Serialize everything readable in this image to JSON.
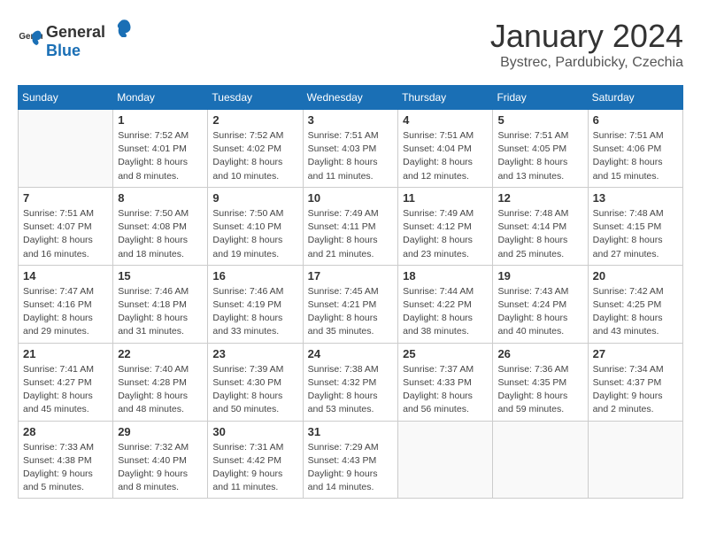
{
  "header": {
    "logo_general": "General",
    "logo_blue": "Blue",
    "month_title": "January 2024",
    "location": "Bystrec, Pardubicky, Czechia"
  },
  "weekdays": [
    "Sunday",
    "Monday",
    "Tuesday",
    "Wednesday",
    "Thursday",
    "Friday",
    "Saturday"
  ],
  "weeks": [
    [
      {
        "day": "",
        "info": ""
      },
      {
        "day": "1",
        "info": "Sunrise: 7:52 AM\nSunset: 4:01 PM\nDaylight: 8 hours\nand 8 minutes."
      },
      {
        "day": "2",
        "info": "Sunrise: 7:52 AM\nSunset: 4:02 PM\nDaylight: 8 hours\nand 10 minutes."
      },
      {
        "day": "3",
        "info": "Sunrise: 7:51 AM\nSunset: 4:03 PM\nDaylight: 8 hours\nand 11 minutes."
      },
      {
        "day": "4",
        "info": "Sunrise: 7:51 AM\nSunset: 4:04 PM\nDaylight: 8 hours\nand 12 minutes."
      },
      {
        "day": "5",
        "info": "Sunrise: 7:51 AM\nSunset: 4:05 PM\nDaylight: 8 hours\nand 13 minutes."
      },
      {
        "day": "6",
        "info": "Sunrise: 7:51 AM\nSunset: 4:06 PM\nDaylight: 8 hours\nand 15 minutes."
      }
    ],
    [
      {
        "day": "7",
        "info": "Sunrise: 7:51 AM\nSunset: 4:07 PM\nDaylight: 8 hours\nand 16 minutes."
      },
      {
        "day": "8",
        "info": "Sunrise: 7:50 AM\nSunset: 4:08 PM\nDaylight: 8 hours\nand 18 minutes."
      },
      {
        "day": "9",
        "info": "Sunrise: 7:50 AM\nSunset: 4:10 PM\nDaylight: 8 hours\nand 19 minutes."
      },
      {
        "day": "10",
        "info": "Sunrise: 7:49 AM\nSunset: 4:11 PM\nDaylight: 8 hours\nand 21 minutes."
      },
      {
        "day": "11",
        "info": "Sunrise: 7:49 AM\nSunset: 4:12 PM\nDaylight: 8 hours\nand 23 minutes."
      },
      {
        "day": "12",
        "info": "Sunrise: 7:48 AM\nSunset: 4:14 PM\nDaylight: 8 hours\nand 25 minutes."
      },
      {
        "day": "13",
        "info": "Sunrise: 7:48 AM\nSunset: 4:15 PM\nDaylight: 8 hours\nand 27 minutes."
      }
    ],
    [
      {
        "day": "14",
        "info": "Sunrise: 7:47 AM\nSunset: 4:16 PM\nDaylight: 8 hours\nand 29 minutes."
      },
      {
        "day": "15",
        "info": "Sunrise: 7:46 AM\nSunset: 4:18 PM\nDaylight: 8 hours\nand 31 minutes."
      },
      {
        "day": "16",
        "info": "Sunrise: 7:46 AM\nSunset: 4:19 PM\nDaylight: 8 hours\nand 33 minutes."
      },
      {
        "day": "17",
        "info": "Sunrise: 7:45 AM\nSunset: 4:21 PM\nDaylight: 8 hours\nand 35 minutes."
      },
      {
        "day": "18",
        "info": "Sunrise: 7:44 AM\nSunset: 4:22 PM\nDaylight: 8 hours\nand 38 minutes."
      },
      {
        "day": "19",
        "info": "Sunrise: 7:43 AM\nSunset: 4:24 PM\nDaylight: 8 hours\nand 40 minutes."
      },
      {
        "day": "20",
        "info": "Sunrise: 7:42 AM\nSunset: 4:25 PM\nDaylight: 8 hours\nand 43 minutes."
      }
    ],
    [
      {
        "day": "21",
        "info": "Sunrise: 7:41 AM\nSunset: 4:27 PM\nDaylight: 8 hours\nand 45 minutes."
      },
      {
        "day": "22",
        "info": "Sunrise: 7:40 AM\nSunset: 4:28 PM\nDaylight: 8 hours\nand 48 minutes."
      },
      {
        "day": "23",
        "info": "Sunrise: 7:39 AM\nSunset: 4:30 PM\nDaylight: 8 hours\nand 50 minutes."
      },
      {
        "day": "24",
        "info": "Sunrise: 7:38 AM\nSunset: 4:32 PM\nDaylight: 8 hours\nand 53 minutes."
      },
      {
        "day": "25",
        "info": "Sunrise: 7:37 AM\nSunset: 4:33 PM\nDaylight: 8 hours\nand 56 minutes."
      },
      {
        "day": "26",
        "info": "Sunrise: 7:36 AM\nSunset: 4:35 PM\nDaylight: 8 hours\nand 59 minutes."
      },
      {
        "day": "27",
        "info": "Sunrise: 7:34 AM\nSunset: 4:37 PM\nDaylight: 9 hours\nand 2 minutes."
      }
    ],
    [
      {
        "day": "28",
        "info": "Sunrise: 7:33 AM\nSunset: 4:38 PM\nDaylight: 9 hours\nand 5 minutes."
      },
      {
        "day": "29",
        "info": "Sunrise: 7:32 AM\nSunset: 4:40 PM\nDaylight: 9 hours\nand 8 minutes."
      },
      {
        "day": "30",
        "info": "Sunrise: 7:31 AM\nSunset: 4:42 PM\nDaylight: 9 hours\nand 11 minutes."
      },
      {
        "day": "31",
        "info": "Sunrise: 7:29 AM\nSunset: 4:43 PM\nDaylight: 9 hours\nand 14 minutes."
      },
      {
        "day": "",
        "info": ""
      },
      {
        "day": "",
        "info": ""
      },
      {
        "day": "",
        "info": ""
      }
    ]
  ]
}
